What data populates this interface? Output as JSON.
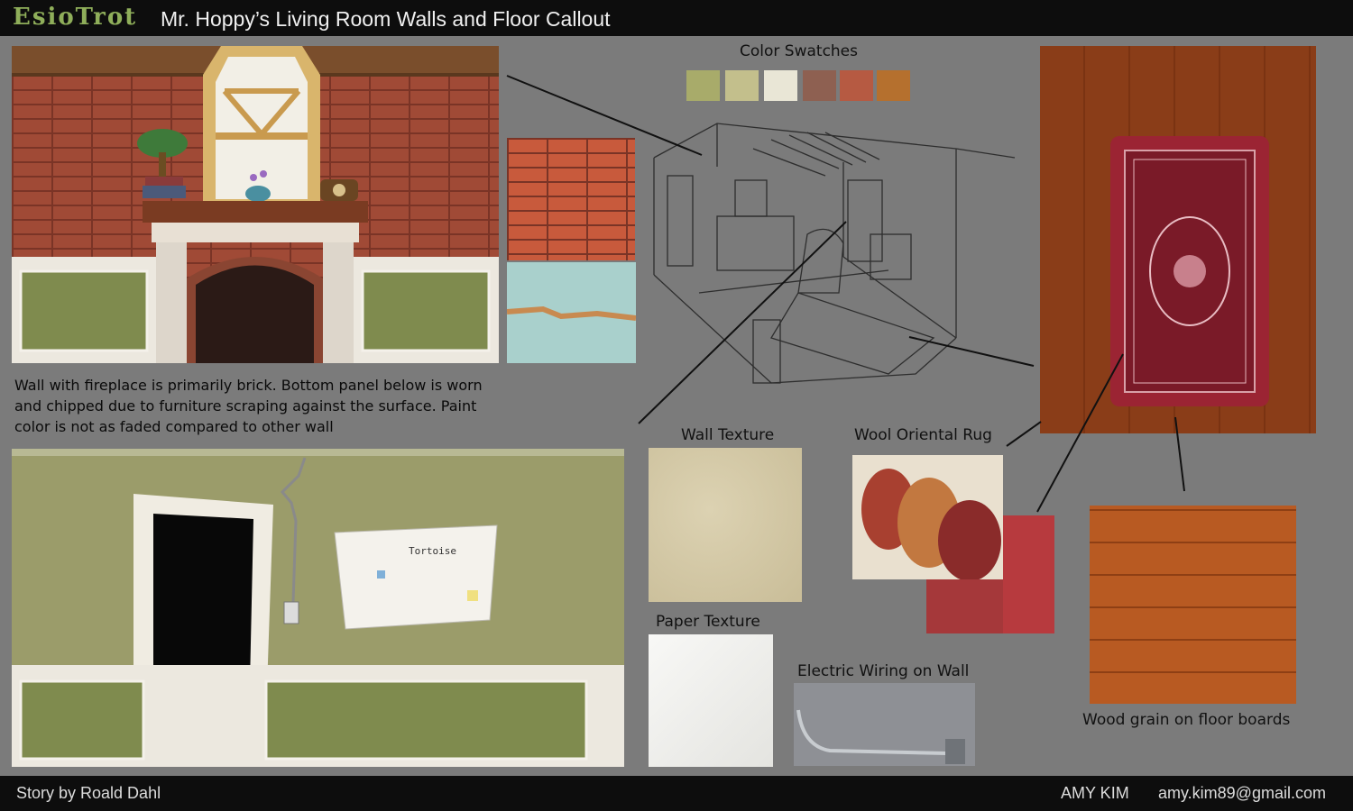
{
  "header": {
    "logo": "EsioTrot",
    "title": "Mr. Hoppy’s Living Room Walls and Floor Callout"
  },
  "labels": {
    "color_swatches": "Color Swatches",
    "wall_texture": "Wall Texture",
    "paper_texture": "Paper Texture",
    "wool_rug": "Wool Oriental Rug",
    "electric_wiring": "Electric Wiring on Wall",
    "wood_grain": "Wood grain on floor boards"
  },
  "caption": "Wall with fireplace is primarily brick. Bottom panel below is worn and chipped due to furniture scraping against the surface. Paint color is not as faded compared to other wall",
  "note_text": "Tortoise",
  "swatches": [
    "#a8ab6a",
    "#c3bf8c",
    "#e9e6d6",
    "#8e6051",
    "#b65a42",
    "#b5702e"
  ],
  "footer": {
    "story": "Story by Roald Dahl",
    "artist": "AMY KIM",
    "email": "amy.kim89@gmail.com"
  }
}
